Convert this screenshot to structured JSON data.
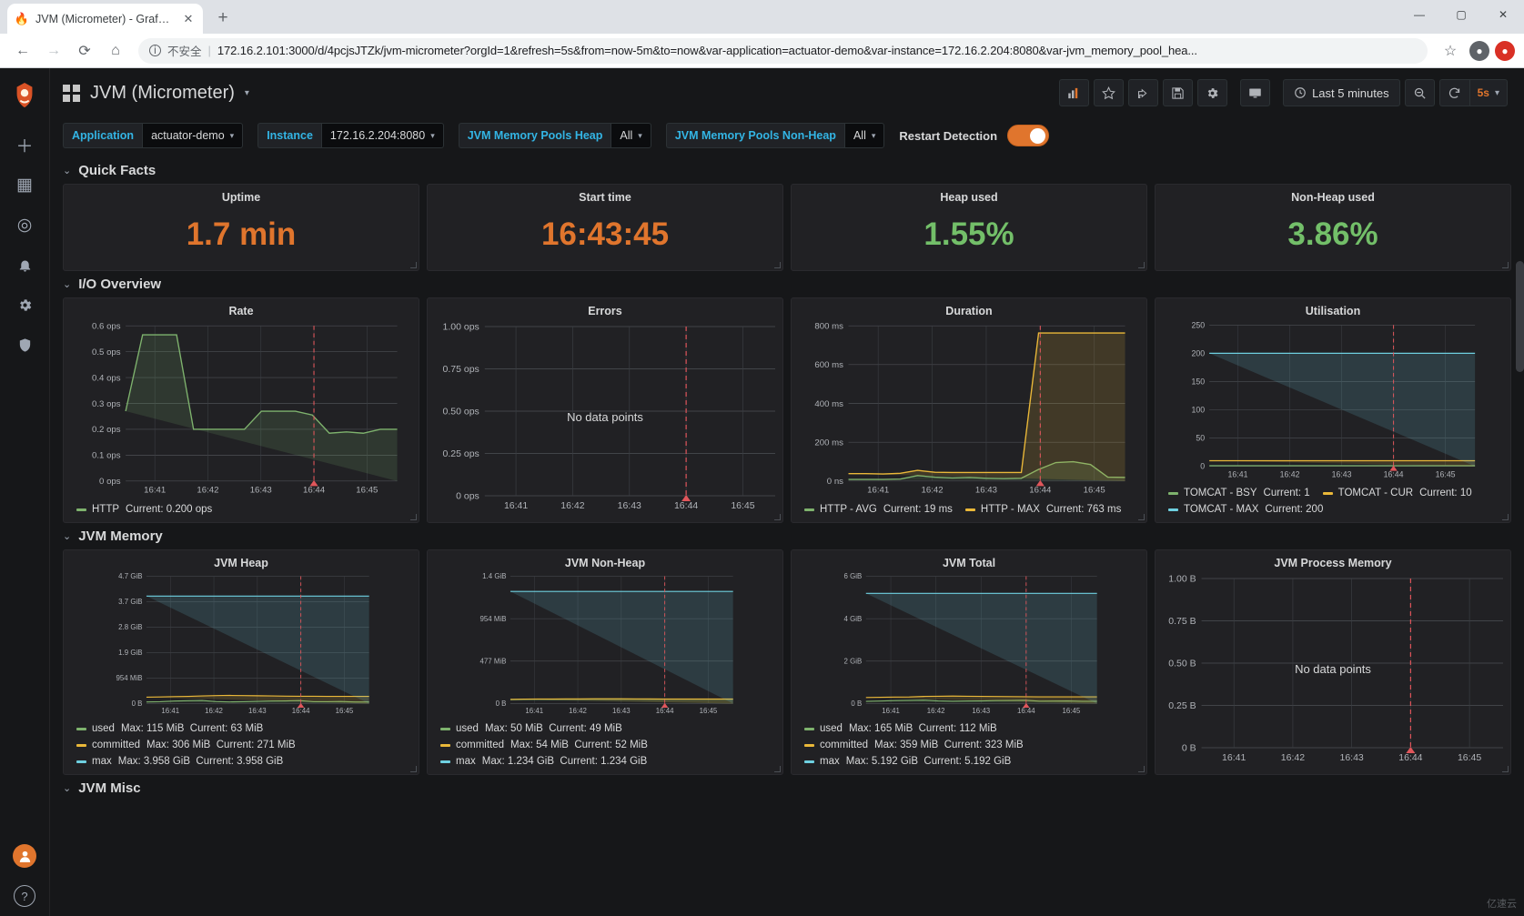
{
  "browser": {
    "tab_title": "JVM (Micrometer) - Grafana",
    "tab_close": "✕",
    "new_tab": "+",
    "minimize": "—",
    "maximize": "▢",
    "close": "✕",
    "back": "←",
    "forward": "→",
    "reload": "⟳",
    "home": "⌂",
    "insecure_label": "不安全",
    "url": "172.16.2.101:3000/d/4pcjsJTZk/jvm-micrometer?orgId=1&refresh=5s&from=now-5m&to=now&var-application=actuator-demo&var-instance=172.16.2.204:8080&var-jvm_memory_pool_hea...",
    "bookmark": "☆",
    "profile": "◉",
    "extension": "●"
  },
  "sidebar": {
    "logo": "grafana-logo",
    "items": [
      {
        "name": "create-add",
        "glyph": "＋"
      },
      {
        "name": "dashboards",
        "glyph": "▦"
      },
      {
        "name": "explore",
        "glyph": "◎"
      },
      {
        "name": "alerting",
        "glyph": "🔔"
      },
      {
        "name": "configuration",
        "glyph": "⚙"
      },
      {
        "name": "server-admin",
        "glyph": "🛡"
      }
    ],
    "bottom": [
      {
        "name": "user-profile",
        "glyph": "user"
      },
      {
        "name": "help",
        "glyph": "?"
      }
    ]
  },
  "header": {
    "title": "JVM (Micrometer)",
    "caret": "▾",
    "buttons": [
      {
        "name": "add-panel",
        "label": "",
        "icon": "add-panel-icon"
      },
      {
        "name": "mark-favorite",
        "label": "",
        "icon": "star-icon"
      },
      {
        "name": "share-dashboard",
        "label": "",
        "icon": "share-icon"
      },
      {
        "name": "save-dashboard",
        "label": "",
        "icon": "save-icon"
      },
      {
        "name": "dashboard-settings",
        "label": "",
        "icon": "gear-icon"
      },
      {
        "name": "cycle-view-mode",
        "label": "",
        "icon": "monitor-icon"
      }
    ],
    "time_range": "Last 5 minutes",
    "time_icon": "clock-icon",
    "zoom_out": "zoom-out-icon",
    "refresh_icon": "refresh-icon",
    "refresh_interval": "5s",
    "refresh_caret": "▾"
  },
  "variables": [
    {
      "name": "application",
      "label": "Application",
      "value": "actuator-demo",
      "caret": "▾"
    },
    {
      "name": "instance",
      "label": "Instance",
      "value": "172.16.2.204:8080",
      "caret": "▾"
    },
    {
      "name": "jvm-memory-pools-heap",
      "label": "JVM Memory Pools Heap",
      "value": "All",
      "caret": "▾"
    },
    {
      "name": "jvm-memory-pools-non-heap",
      "label": "JVM Memory Pools Non-Heap",
      "value": "All",
      "caret": "▾"
    }
  ],
  "restart_detection": {
    "label": "Restart Detection",
    "state": "on"
  },
  "rows": [
    {
      "name": "quick-facts",
      "title": "Quick Facts",
      "caret": "⌄"
    },
    {
      "name": "io-overview",
      "title": "I/O Overview",
      "caret": "⌄"
    },
    {
      "name": "jvm-memory",
      "title": "JVM Memory",
      "caret": "⌄"
    },
    {
      "name": "jvm-misc",
      "title": "JVM Misc",
      "caret": "⌄"
    }
  ],
  "stats": [
    {
      "name": "uptime",
      "title": "Uptime",
      "value": "1.7 min",
      "color": "#e0752d"
    },
    {
      "name": "start-time",
      "title": "Start time",
      "value": "16:43:45",
      "color": "#e0752d"
    },
    {
      "name": "heap-used",
      "title": "Heap used",
      "value": "1.55%",
      "color": "#73bf69"
    },
    {
      "name": "non-heap-used",
      "title": "Non-Heap used",
      "value": "3.86%",
      "color": "#73bf69"
    }
  ],
  "chart_data": [
    {
      "name": "rate",
      "type": "area",
      "title": "Rate",
      "xlabel": "",
      "ylabel": "",
      "x_ticks": [
        "16:41",
        "16:42",
        "16:43",
        "16:44",
        "16:45"
      ],
      "y_ticks": [
        "0 ops",
        "0.1 ops",
        "0.2 ops",
        "0.3 ops",
        "0.4 ops",
        "0.5 ops",
        "0.6 ops"
      ],
      "ylim": [
        0,
        0.6
      ],
      "grid": true,
      "legend_position": "bottom",
      "annotation_time": "16:44",
      "series": [
        {
          "name": "HTTP",
          "stat_label": "Current:",
          "stat_value": "0.200 ops",
          "color": "#7eb26d",
          "values": [
            0.27,
            0.565,
            0.565,
            0.565,
            0.2,
            0.2,
            0.2,
            0.2,
            0.27,
            0.27,
            0.27,
            0.255,
            0.185,
            0.19,
            0.185,
            0.2,
            0.2
          ]
        }
      ]
    },
    {
      "name": "errors",
      "type": "area",
      "title": "Errors",
      "x_ticks": [
        "16:41",
        "16:42",
        "16:43",
        "16:44",
        "16:45"
      ],
      "y_ticks": [
        "0 ops",
        "0.25 ops",
        "0.50 ops",
        "0.75 ops",
        "1.00 ops"
      ],
      "ylim": [
        0,
        1.0
      ],
      "grid": true,
      "empty_message": "No data points",
      "annotation_time": "16:44",
      "series": []
    },
    {
      "name": "duration",
      "type": "area",
      "title": "Duration",
      "x_ticks": [
        "16:41",
        "16:42",
        "16:43",
        "16:44",
        "16:45"
      ],
      "y_ticks": [
        "0 ns",
        "200 ms",
        "400 ms",
        "600 ms",
        "800 ms"
      ],
      "ylim": [
        0,
        800
      ],
      "grid": true,
      "legend_position": "bottom",
      "annotation_time": "16:44",
      "series": [
        {
          "name": "HTTP - AVG",
          "stat_label": "Current:",
          "stat_value": "19 ms",
          "color": "#7eb26d",
          "values": [
            8,
            8,
            8,
            10,
            28,
            20,
            16,
            18,
            14,
            12,
            14,
            60,
            95,
            100,
            85,
            20,
            19
          ]
        },
        {
          "name": "HTTP - MAX",
          "stat_label": "Current:",
          "stat_value": "763 ms",
          "color": "#eab839",
          "values": [
            38,
            38,
            36,
            40,
            55,
            45,
            44,
            44,
            44,
            44,
            44,
            763,
            763,
            763,
            763,
            763,
            763
          ]
        }
      ]
    },
    {
      "name": "utilisation",
      "type": "line",
      "title": "Utilisation",
      "x_ticks": [
        "16:41",
        "16:42",
        "16:43",
        "16:44",
        "16:45"
      ],
      "y_ticks": [
        "0",
        "50",
        "100",
        "150",
        "200",
        "250"
      ],
      "ylim": [
        0,
        250
      ],
      "grid": true,
      "legend_position": "bottom",
      "annotation_time": "16:44",
      "series": [
        {
          "name": "TOMCAT - BSY",
          "stat_label": "Current:",
          "stat_value": "1",
          "color": "#7eb26d",
          "values": [
            1,
            1,
            1,
            1,
            1,
            1,
            1,
            1,
            1,
            1,
            1,
            1,
            1,
            1,
            1,
            1,
            1
          ]
        },
        {
          "name": "TOMCAT - CUR",
          "stat_label": "Current:",
          "stat_value": "10",
          "color": "#eab839",
          "values": [
            10,
            10,
            10,
            10,
            10,
            10,
            10,
            10,
            10,
            10,
            10,
            10,
            10,
            10,
            10,
            10,
            10
          ]
        },
        {
          "name": "TOMCAT - MAX",
          "stat_label": "Current:",
          "stat_value": "200",
          "color": "#6ed0e0",
          "values": [
            200,
            200,
            200,
            200,
            200,
            200,
            200,
            200,
            200,
            200,
            200,
            200,
            200,
            200,
            200,
            200,
            200
          ]
        }
      ]
    },
    {
      "name": "jvm-heap",
      "type": "area",
      "title": "JVM Heap",
      "x_ticks": [
        "16:41",
        "16:42",
        "16:43",
        "16:44",
        "16:45"
      ],
      "y_ticks": [
        "0 B",
        "954 MiB",
        "1.9 GiB",
        "2.8 GiB",
        "3.7 GiB",
        "4.7 GiB"
      ],
      "ylim": [
        0,
        4800
      ],
      "grid": true,
      "legend_position": "bottom",
      "annotation_time": "16:44",
      "series": [
        {
          "name": "used",
          "stat_label": "Max: 115 MiB  Current: 63 MiB",
          "max": "115 MiB",
          "current": "63 MiB",
          "color": "#7eb26d",
          "values": [
            60,
            70,
            95,
            105,
            115,
            75,
            62,
            70,
            80,
            92,
            100,
            110,
            66,
            70,
            78,
            60,
            63
          ]
        },
        {
          "name": "committed",
          "stat_label": "Max: 306 MiB  Current: 271 MiB",
          "max": "306 MiB",
          "current": "271 MiB",
          "color": "#eab839",
          "values": [
            240,
            250,
            262,
            270,
            290,
            300,
            306,
            300,
            295,
            288,
            280,
            276,
            274,
            272,
            271,
            271,
            271
          ]
        },
        {
          "name": "max",
          "stat_label": "Max: 3.958 GiB  Current: 3.958 GiB",
          "max": "3.958 GiB",
          "current": "3.958 GiB",
          "color": "#6ed0e0",
          "values": [
            4053,
            4053,
            4053,
            4053,
            4053,
            4053,
            4053,
            4053,
            4053,
            4053,
            4053,
            4053,
            4053,
            4053,
            4053,
            4053,
            4053
          ]
        }
      ]
    },
    {
      "name": "jvm-non-heap",
      "type": "area",
      "title": "JVM Non-Heap",
      "x_ticks": [
        "16:41",
        "16:42",
        "16:43",
        "16:44",
        "16:45"
      ],
      "y_ticks": [
        "0 B",
        "477 MiB",
        "954 MiB",
        "1.4 GiB"
      ],
      "ylim": [
        0,
        1434
      ],
      "grid": true,
      "legend_position": "bottom",
      "annotation_time": "16:44",
      "series": [
        {
          "name": "used",
          "stat_label": "Max: 50 MiB  Current: 49 MiB",
          "max": "50 MiB",
          "current": "49 MiB",
          "color": "#7eb26d",
          "values": [
            44,
            46,
            47,
            48,
            49,
            49,
            50,
            50,
            50,
            50,
            49,
            49,
            49,
            49,
            49,
            49,
            49
          ]
        },
        {
          "name": "committed",
          "stat_label": "Max: 54 MiB  Current: 52 MiB",
          "max": "54 MiB",
          "current": "52 MiB",
          "color": "#eab839",
          "values": [
            48,
            50,
            51,
            52,
            53,
            53,
            54,
            54,
            54,
            53,
            53,
            52,
            52,
            52,
            52,
            52,
            52
          ]
        },
        {
          "name": "max",
          "stat_label": "Max: 1.234 GiB  Current: 1.234 GiB",
          "max": "1.234 GiB",
          "current": "1.234 GiB",
          "color": "#6ed0e0",
          "values": [
            1263,
            1263,
            1263,
            1263,
            1263,
            1263,
            1263,
            1263,
            1263,
            1263,
            1263,
            1263,
            1263,
            1263,
            1263,
            1263,
            1263
          ]
        }
      ]
    },
    {
      "name": "jvm-total",
      "type": "area",
      "title": "JVM Total",
      "x_ticks": [
        "16:41",
        "16:42",
        "16:43",
        "16:44",
        "16:45"
      ],
      "y_ticks": [
        "0 B",
        "2 GiB",
        "4 GiB",
        "6 GiB"
      ],
      "ylim": [
        0,
        6144
      ],
      "grid": true,
      "legend_position": "bottom",
      "annotation_time": "16:44",
      "series": [
        {
          "name": "used",
          "stat_label": "Max: 165 MiB  Current: 112 MiB",
          "max": "165 MiB",
          "current": "112 MiB",
          "color": "#7eb26d",
          "values": [
            105,
            118,
            142,
            155,
            165,
            124,
            112,
            120,
            130,
            142,
            150,
            160,
            116,
            120,
            128,
            110,
            112
          ]
        },
        {
          "name": "committed",
          "stat_label": "Max: 359 MiB  Current: 323 MiB",
          "max": "359 MiB",
          "current": "323 MiB",
          "color": "#eab839",
          "values": [
            290,
            300,
            314,
            322,
            344,
            354,
            359,
            354,
            348,
            341,
            333,
            329,
            326,
            324,
            323,
            323,
            323
          ]
        },
        {
          "name": "max",
          "stat_label": "Max: 5.192 GiB  Current: 5.192 GiB",
          "max": "5.192 GiB",
          "current": "5.192 GiB",
          "color": "#6ed0e0",
          "values": [
            5317,
            5317,
            5317,
            5317,
            5317,
            5317,
            5317,
            5317,
            5317,
            5317,
            5317,
            5317,
            5317,
            5317,
            5317,
            5317,
            5317
          ]
        }
      ]
    },
    {
      "name": "jvm-process-memory",
      "type": "area",
      "title": "JVM Process Memory",
      "x_ticks": [
        "16:41",
        "16:42",
        "16:43",
        "16:44",
        "16:45"
      ],
      "y_ticks": [
        "0 B",
        "0.25 B",
        "0.50 B",
        "0.75 B",
        "1.00 B"
      ],
      "ylim": [
        0,
        1
      ],
      "grid": true,
      "empty_message": "No data points",
      "annotation_time": "16:44",
      "series": []
    }
  ],
  "watermark": "亿速云"
}
